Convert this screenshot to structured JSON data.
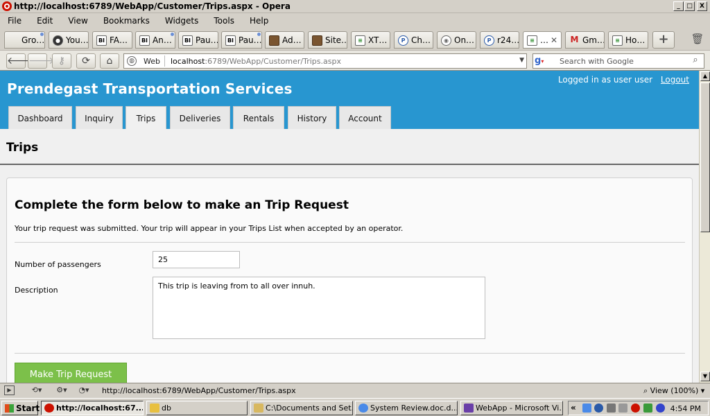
{
  "window": {
    "title": "http://localhost:6789/WebApp/Customer/Trips.aspx - Opera",
    "min_label": "_",
    "max_label": "□",
    "close_label": "X"
  },
  "menu": [
    "File",
    "Edit",
    "View",
    "Bookmarks",
    "Widgets",
    "Tools",
    "Help"
  ],
  "browser_tabs": [
    {
      "label": "Gro…",
      "icon": "blank"
    },
    {
      "label": "You…",
      "icon": "github"
    },
    {
      "label": "FA…",
      "icon": "BI"
    },
    {
      "label": "An…",
      "icon": "BI"
    },
    {
      "label": "Pau…",
      "icon": "BI"
    },
    {
      "label": "Pau…",
      "icon": "BI"
    },
    {
      "label": "Ad…",
      "icon": "person"
    },
    {
      "label": "Site…",
      "icon": "person"
    },
    {
      "label": "XT…",
      "icon": "page"
    },
    {
      "label": "Ch…",
      "icon": "P"
    },
    {
      "label": "On…",
      "icon": "cam"
    },
    {
      "label": "r24…",
      "icon": "P"
    },
    {
      "label": "…",
      "icon": "page",
      "active": true,
      "close": "✕"
    },
    {
      "label": "Gm…",
      "icon": "M"
    },
    {
      "label": "Ho…",
      "icon": "page"
    }
  ],
  "new_tab_label": "+",
  "address": {
    "scheme_label": "Web",
    "url_host": "localhost",
    "url_rest": ":6789/WebApp/Customer/Trips.aspx",
    "search_placeholder": "Search with Google"
  },
  "site": {
    "title": "Prendegast Transportation Services",
    "logged_in_text": "Logged in as user user",
    "logout_label": "Logout",
    "nav": [
      "Dashboard",
      "Inquiry",
      "Trips",
      "Deliveries",
      "Rentals",
      "History",
      "Account"
    ],
    "current_nav": "Trips"
  },
  "page": {
    "heading": "Trips",
    "form_title": "Complete the form below to make an Trip Request",
    "form_message": "Your trip request was submitted. Your trip will appear in your Trips List when accepted by an operator.",
    "passengers_label": "Number of passengers",
    "passengers_value": "25",
    "description_label": "Description",
    "description_value": "This trip is leaving from to all over innuh.",
    "submit_label": "Make Trip Request"
  },
  "statusbar": {
    "url": "http://localhost:6789/WebApp/Customer/Trips.aspx",
    "zoom": "View (100%)"
  },
  "taskbar": {
    "start_label": "Start",
    "tasks": [
      {
        "label": "http://localhost:67...",
        "icon_color": "#cc1100",
        "active": true
      },
      {
        "label": "db",
        "icon_color": "#e8c040"
      },
      {
        "label": "C:\\Documents and Set...",
        "icon_color": "#d8b860"
      },
      {
        "label": "System Review.doc.d...",
        "icon_color": "#4a8ae8"
      },
      {
        "label": "WebApp - Microsoft Vi...",
        "icon_color": "#6a3fa8"
      }
    ],
    "clock": "4:54 PM"
  }
}
